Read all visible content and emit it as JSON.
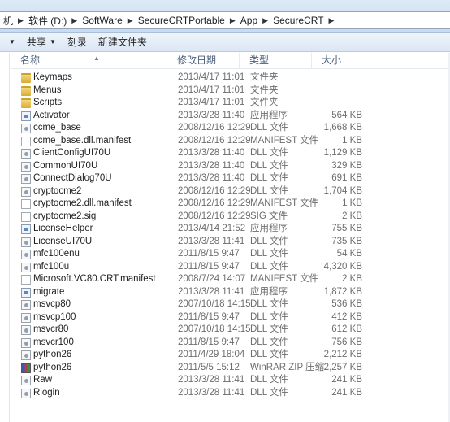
{
  "breadcrumb": [
    "机",
    "软件 (D:)",
    "SoftWare",
    "SecureCRTPortable",
    "App",
    "SecureCRT"
  ],
  "toolbar": {
    "share_label": "共享",
    "burn_label": "刻录",
    "new_folder_label": "新建文件夹"
  },
  "columns": {
    "name": "名称",
    "date": "修改日期",
    "type": "类型",
    "size": "大小"
  },
  "files": [
    {
      "name": "Keymaps",
      "date": "2013/4/17 11:01",
      "type": "文件夹",
      "size": "",
      "icon": "folder-icon"
    },
    {
      "name": "Menus",
      "date": "2013/4/17 11:01",
      "type": "文件夹",
      "size": "",
      "icon": "folder-icon"
    },
    {
      "name": "Scripts",
      "date": "2013/4/17 11:01",
      "type": "文件夹",
      "size": "",
      "icon": "folder-icon"
    },
    {
      "name": "Activator",
      "date": "2013/3/28 11:40",
      "type": "应用程序",
      "size": "564 KB",
      "icon": "application-icon"
    },
    {
      "name": "ccme_base",
      "date": "2008/12/16 12:29",
      "type": "DLL 文件",
      "size": "1,668 KB",
      "icon": "dll-icon"
    },
    {
      "name": "ccme_base.dll.manifest",
      "date": "2008/12/16 12:29",
      "type": "MANIFEST 文件",
      "size": "1 KB",
      "icon": "file-icon"
    },
    {
      "name": "ClientConfigUI70U",
      "date": "2013/3/28 11:40",
      "type": "DLL 文件",
      "size": "1,129 KB",
      "icon": "dll-icon"
    },
    {
      "name": "CommonUI70U",
      "date": "2013/3/28 11:40",
      "type": "DLL 文件",
      "size": "329 KB",
      "icon": "dll-icon"
    },
    {
      "name": "ConnectDialog70U",
      "date": "2013/3/28 11:40",
      "type": "DLL 文件",
      "size": "691 KB",
      "icon": "dll-icon"
    },
    {
      "name": "cryptocme2",
      "date": "2008/12/16 12:29",
      "type": "DLL 文件",
      "size": "1,704 KB",
      "icon": "dll-icon"
    },
    {
      "name": "cryptocme2.dll.manifest",
      "date": "2008/12/16 12:29",
      "type": "MANIFEST 文件",
      "size": "1 KB",
      "icon": "file-icon"
    },
    {
      "name": "cryptocme2.sig",
      "date": "2008/12/16 12:29",
      "type": "SIG 文件",
      "size": "2 KB",
      "icon": "file-icon"
    },
    {
      "name": "LicenseHelper",
      "date": "2013/4/14 21:52",
      "type": "应用程序",
      "size": "755 KB",
      "icon": "application-icon"
    },
    {
      "name": "LicenseUI70U",
      "date": "2013/3/28 11:41",
      "type": "DLL 文件",
      "size": "735 KB",
      "icon": "dll-icon"
    },
    {
      "name": "mfc100enu",
      "date": "2011/8/15 9:47",
      "type": "DLL 文件",
      "size": "54 KB",
      "icon": "dll-icon"
    },
    {
      "name": "mfc100u",
      "date": "2011/8/15 9:47",
      "type": "DLL 文件",
      "size": "4,320 KB",
      "icon": "dll-icon"
    },
    {
      "name": "Microsoft.VC80.CRT.manifest",
      "date": "2008/7/24 14:07",
      "type": "MANIFEST 文件",
      "size": "2 KB",
      "icon": "file-icon"
    },
    {
      "name": "migrate",
      "date": "2013/3/28 11:41",
      "type": "应用程序",
      "size": "1,872 KB",
      "icon": "application-icon"
    },
    {
      "name": "msvcp80",
      "date": "2007/10/18 14:15",
      "type": "DLL 文件",
      "size": "536 KB",
      "icon": "dll-icon"
    },
    {
      "name": "msvcp100",
      "date": "2011/8/15 9:47",
      "type": "DLL 文件",
      "size": "412 KB",
      "icon": "dll-icon"
    },
    {
      "name": "msvcr80",
      "date": "2007/10/18 14:15",
      "type": "DLL 文件",
      "size": "612 KB",
      "icon": "dll-icon"
    },
    {
      "name": "msvcr100",
      "date": "2011/8/15 9:47",
      "type": "DLL 文件",
      "size": "756 KB",
      "icon": "dll-icon"
    },
    {
      "name": "python26",
      "date": "2011/4/29 18:04",
      "type": "DLL 文件",
      "size": "2,212 KB",
      "icon": "dll-icon"
    },
    {
      "name": "python26",
      "date": "2011/5/5 15:12",
      "type": "WinRAR ZIP 压缩...",
      "size": "2,257 KB",
      "icon": "zip-archive-icon"
    },
    {
      "name": "Raw",
      "date": "2013/3/28 11:41",
      "type": "DLL 文件",
      "size": "241 KB",
      "icon": "dll-icon"
    },
    {
      "name": "Rlogin",
      "date": "2013/3/28 11:41",
      "type": "DLL 文件",
      "size": "241 KB",
      "icon": "dll-icon"
    }
  ]
}
